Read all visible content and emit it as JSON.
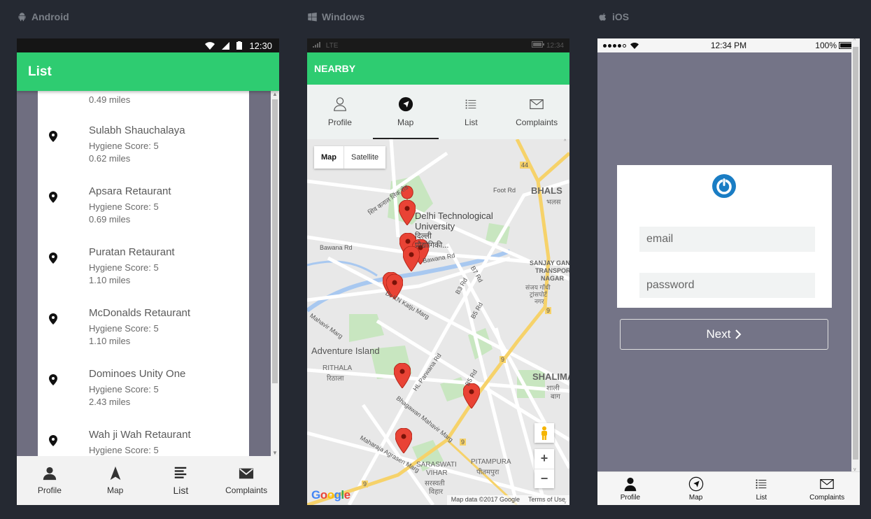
{
  "platforms": {
    "android": "Android",
    "windows": "Windows",
    "ios": "iOS"
  },
  "android": {
    "status_time": "12:30",
    "title": "List",
    "first_partial_distance": "0.49 miles",
    "items": [
      {
        "name": "Sulabh Shauchalaya",
        "score": "Hygiene Score: 5",
        "distance": "0.62 miles"
      },
      {
        "name": "Apsara Retaurant",
        "score": "Hygiene Score: 5",
        "distance": "0.69 miles"
      },
      {
        "name": "Puratan Retaurant",
        "score": "Hygiene Score: 5",
        "distance": "1.10 miles"
      },
      {
        "name": "McDonalds Retaurant",
        "score": "Hygiene Score: 5",
        "distance": "1.10 miles"
      },
      {
        "name": "Dominoes Unity One",
        "score": "Hygiene Score: 5",
        "distance": "2.43 miles"
      },
      {
        "name": "Wah ji Wah Retaurant",
        "score": "Hygiene Score: 5",
        "distance": ""
      }
    ],
    "nav": {
      "profile": "Profile",
      "map": "Map",
      "list": "List",
      "complaints": "Complaints"
    }
  },
  "windows": {
    "status_network": "LTE",
    "status_time": "12:34",
    "title": "NEARBY",
    "tabs": {
      "profile": "Profile",
      "map": "Map",
      "list": "List",
      "complaints": "Complaints"
    },
    "map": {
      "type_map": "Map",
      "type_satellite": "Satellite",
      "attribution": "Map data ©2017 Google",
      "terms": "Terms of Use",
      "google": "Google",
      "zoom_in": "+",
      "zoom_out": "−",
      "labels": {
        "dtu1": "Delhi Technological",
        "dtu2": "University",
        "dtu3": "दिल्ली",
        "dtu4": "प्रौद्योगिकी...",
        "bhals": "BHALS",
        "bhals_hi": "भलस",
        "sanjay1": "SANJAY GANDI",
        "sanjay2": "TRANSPORT",
        "sanjay3": "NAGAR",
        "sanjay4": "संजय गाँधी",
        "sanjay5": "ट्रांसपोर्ट",
        "sanjay6": "नगर",
        "adventure": "Adventure Island",
        "rithala": "RITHALA",
        "rithala_hi": "रिठाला",
        "shalimar": "SHALIMA",
        "shalimar_hi1": "शाली",
        "shalimar_hi2": "बाग",
        "saraswati1": "SARASWATI",
        "saraswati2": "VIHAR",
        "saraswati3": "सरस्वती",
        "saraswati4": "विहार",
        "pitampura": "PITAMPURA",
        "pitampura_hi": "पीतमपुरा"
      },
      "roads": {
        "bawana1": "Bawana Rd",
        "bawana2": "Bawana Rd",
        "footrd": "Foot Rd",
        "katju": "Dr KN Katju Marg",
        "mahavir": "Mahavir Marg",
        "b3": "B3 Rd",
        "b7": "B7 Rd",
        "b5": "B5 Rd",
        "b5b": "B5 Rd",
        "hlparwana": "HL Parwana Rd",
        "bhagawan": "Bhagawan Mahavir Marg",
        "agrasen": "Maharaja Agrasen Marg",
        "shiv": "शिव कनाल लिंक रोड",
        "r44": "44",
        "r9a": "9",
        "r9b": "9",
        "r9c": "9",
        "r9d": "9"
      }
    }
  },
  "ios": {
    "status_time": "12:34 PM",
    "battery": "100%",
    "email_placeholder": "email",
    "password_placeholder": "password",
    "next_label": "Next",
    "nav": {
      "profile": "Profile",
      "map": "Map",
      "list": "List",
      "complaints": "Complaints"
    }
  },
  "colors": {
    "accent_green": "#2ecc71",
    "background": "#252932",
    "overlay_gray": "#747487",
    "pin_red": "#e94335"
  }
}
